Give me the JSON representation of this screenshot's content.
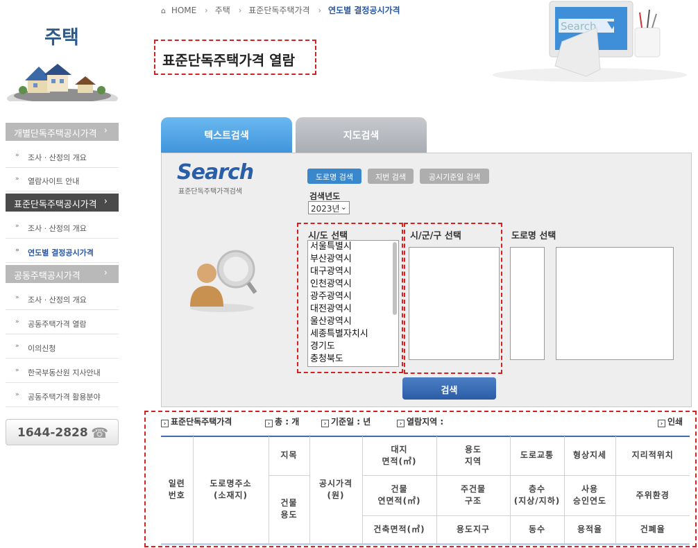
{
  "sidebar": {
    "title": "주택",
    "categories": [
      {
        "label": "개별단독주택공시가격",
        "items": [
          "조사 · 산정의 개요",
          "열람사이트 안내"
        ]
      },
      {
        "label": "표준단독주택공시가격",
        "items": [
          "조사 · 산정의 개요",
          "연도별 결정공시가격"
        ]
      },
      {
        "label": "공동주택공시가격",
        "items": [
          "조사 · 산정의 개요",
          "공동주택가격 열람",
          "이의신청",
          "한국부동산원 지사안내",
          "공동주택가격 활용분야"
        ]
      }
    ],
    "chevron": "›",
    "bullet": "»",
    "phone": "1644-2828",
    "phone_icon": "telephone-icon"
  },
  "breadcrumb": {
    "home": "HOME",
    "items": [
      "주택",
      "표준단독주택가격"
    ],
    "current": "연도별 결정공시가격"
  },
  "page_title": "표준단독주택가격 열람",
  "header_graphic": {
    "search_text": "Search"
  },
  "tabs": [
    {
      "label": "텍스트검색",
      "active": true
    },
    {
      "label": "지도검색",
      "active": false
    }
  ],
  "search_panel": {
    "logo": "Search",
    "logo_sub": "표준단독주택가격검색",
    "modes": [
      "도로명 검색",
      "지번 검색",
      "공시기준일 검색"
    ],
    "year_label": "검색년도",
    "year_value": "2023년",
    "sido_label": "시/도 선택",
    "sigungu_label": "시/군/구 선택",
    "road_label": "도로명 선택",
    "sido_options": [
      "서울특별시",
      "부산광역시",
      "대구광역시",
      "인천광역시",
      "광주광역시",
      "대전광역시",
      "울산광역시",
      "세종특별자치시",
      "경기도",
      "충청북도"
    ],
    "search_button": "검색"
  },
  "result_info": {
    "std": "표준단독주택가격",
    "total": "총 : 개",
    "date": "기준일 : 년",
    "area": "열람지역 :",
    "print": "인쇄"
  },
  "table": {
    "serial": "일련\n번호",
    "address": "도로명주소\n(소재지)",
    "jimok": "지목",
    "building_use": "건물\n용도",
    "price": "공시가격\n(원)",
    "land_area": "대지\n면적(㎡)",
    "floor_area": "건물\n연면적(㎡)",
    "building_area": "건축면적(㎡)",
    "zone": "용도\n지역",
    "structure": "주건물\n구조",
    "district": "용도지구",
    "road": "도로교통",
    "floors": "층수\n(지상/지하)",
    "dong": "동수",
    "shape": "형상지세",
    "approval": "사용\n승인연도",
    "far": "용적율",
    "location": "지리적위치",
    "env": "주위환경",
    "bcr": "건폐율"
  }
}
